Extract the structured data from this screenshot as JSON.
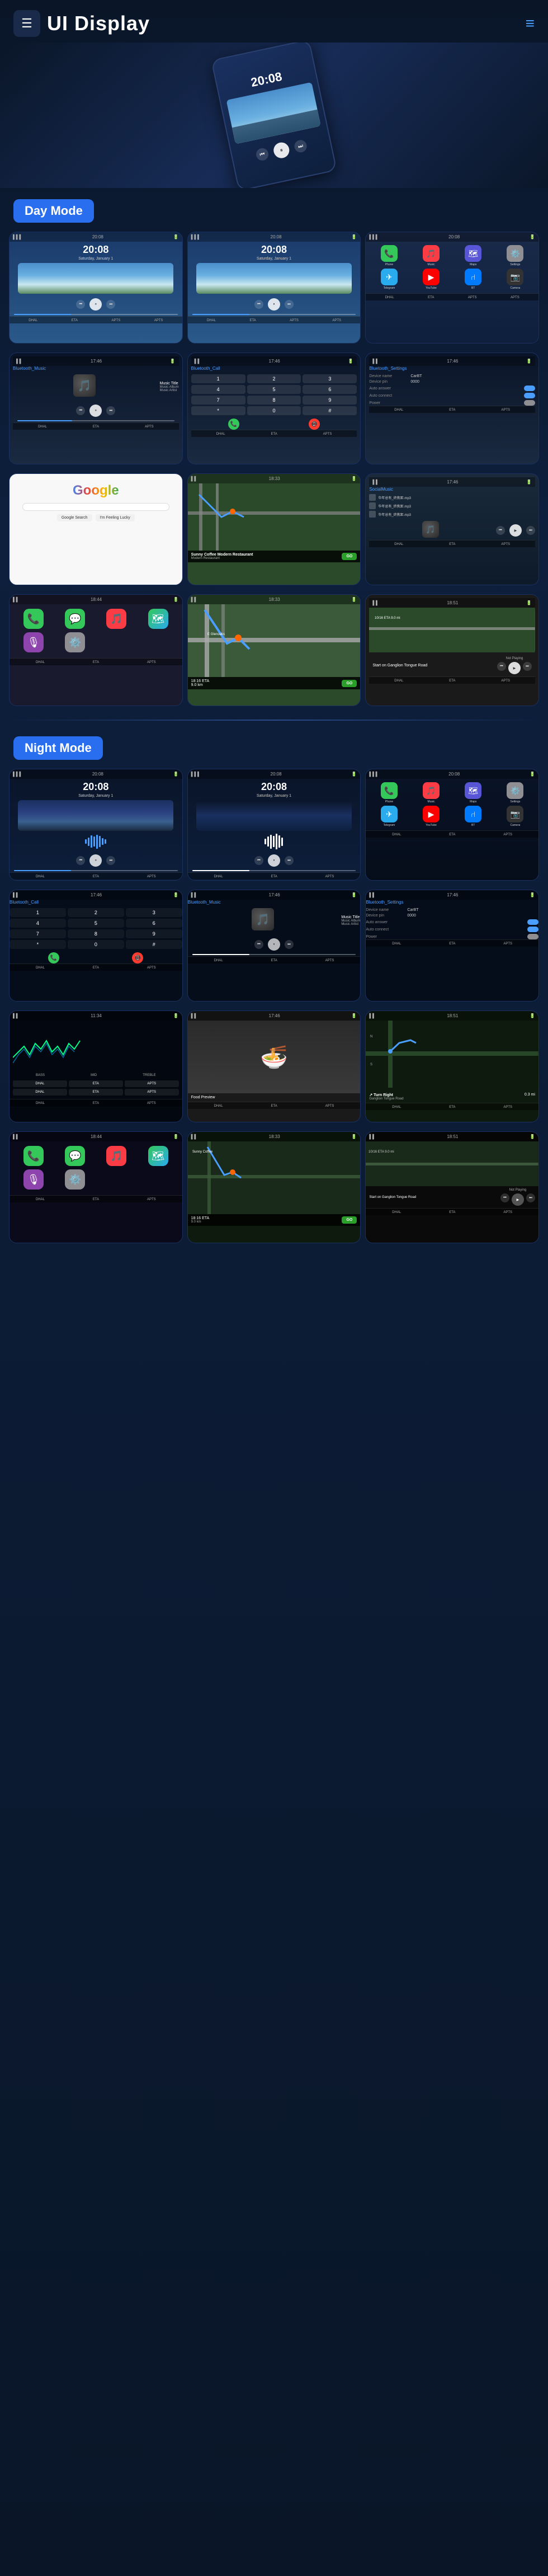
{
  "header": {
    "title": "UI Display",
    "logo_symbol": "☰",
    "menu_symbol": "≡"
  },
  "sections": {
    "day_mode": "Day Mode",
    "night_mode": "Night Mode"
  },
  "screens": {
    "time": "20:08",
    "subtitle": "Saturday, January 1",
    "music_title": "Music Title",
    "music_album": "Music Album",
    "music_artist": "Music Artist",
    "bluetooth_music": "Bluetooth_Music",
    "bluetooth_call": "Bluetooth_Call",
    "bluetooth_settings": "Bluetooth_Settings",
    "device_name_label": "Device name",
    "device_name": "CarBT",
    "device_pin_label": "Device pin",
    "device_pin": "0000",
    "auto_answer_label": "Auto answer",
    "auto_connect_label": "Auto connect",
    "power_label": "Power",
    "google_text": "Google",
    "nav_restaurant": "Sunny Coffee Modern Restaurant",
    "nav_eta": "10:16 ETA",
    "nav_distance": "9.0 km",
    "local_music_title": "SocialMusic",
    "not_playing": "Not Playing",
    "start_on": "Start on Ganglion Tongue Road"
  },
  "footer_items": [
    "DHAL",
    "ETA",
    "APTS",
    "APTS"
  ],
  "app_colors": {
    "phone": "#34c759",
    "messages": "#34c759",
    "music": "#fc3c44",
    "maps": "#5856d6",
    "settings": "#8e8e93",
    "bluetooth": "#007aff",
    "telegram": "#2aabee",
    "youtube": "#ff0000",
    "camera": "#333",
    "weather": "#007aff"
  }
}
